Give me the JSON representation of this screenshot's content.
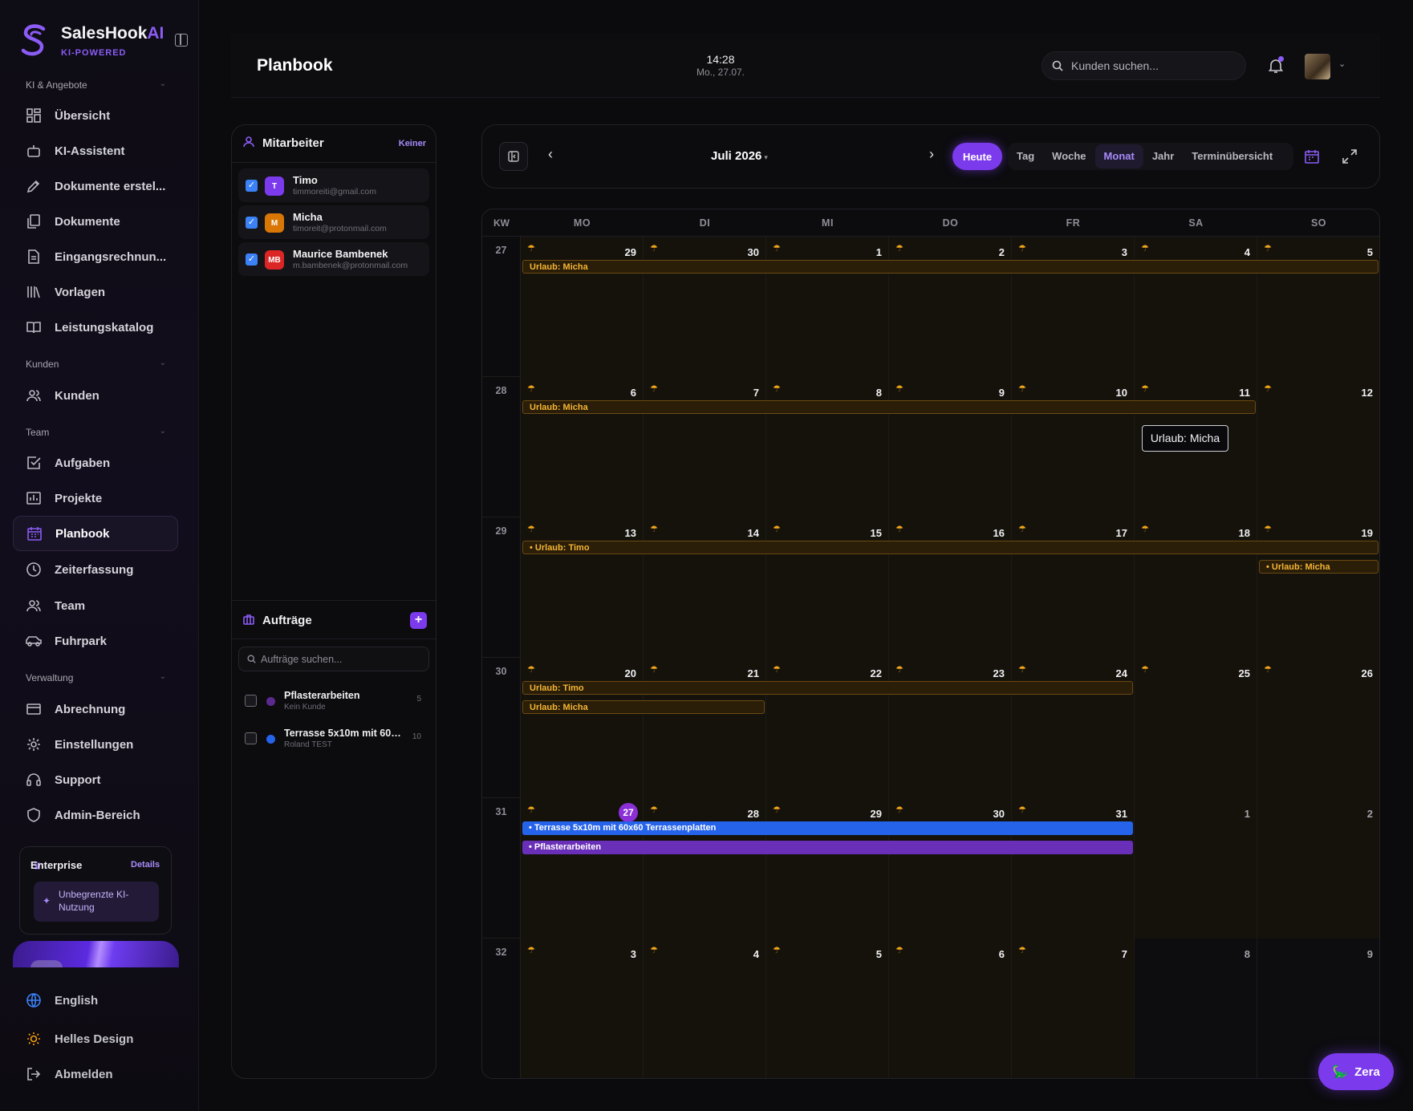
{
  "brand": {
    "name": "SalesHook",
    "name_ai": "AI",
    "tagline": "KI-POWERED"
  },
  "sidebar": {
    "sections": [
      {
        "label": "KI & Angebote"
      },
      {
        "label": "Kunden"
      },
      {
        "label": "Team"
      },
      {
        "label": "Verwaltung"
      }
    ],
    "items": [
      {
        "label": "Übersicht",
        "icon": "dashboard-icon"
      },
      {
        "label": "KI-Assistent",
        "icon": "robot-icon"
      },
      {
        "label": "Dokumente erstel...",
        "icon": "pen-icon"
      },
      {
        "label": "Dokumente",
        "icon": "documents-icon"
      },
      {
        "label": "Eingangsrechnun...",
        "icon": "invoice-icon"
      },
      {
        "label": "Vorlagen",
        "icon": "library-icon"
      },
      {
        "label": "Leistungskatalog",
        "icon": "book-icon"
      },
      {
        "label": "Kunden",
        "icon": "users-icon"
      },
      {
        "label": "Aufgaben",
        "icon": "check-square-icon"
      },
      {
        "label": "Projekte",
        "icon": "chart-icon"
      },
      {
        "label": "Planbook",
        "icon": "calendar-icon",
        "active": true
      },
      {
        "label": "Zeiterfassung",
        "icon": "clock-icon"
      },
      {
        "label": "Team",
        "icon": "team-icon"
      },
      {
        "label": "Fuhrpark",
        "icon": "car-icon"
      },
      {
        "label": "Abrechnung",
        "icon": "credit-card-icon"
      },
      {
        "label": "Einstellungen",
        "icon": "gear-icon"
      },
      {
        "label": "Support",
        "icon": "headset-icon"
      },
      {
        "label": "Admin-Bereich",
        "icon": "shield-icon"
      }
    ],
    "plan": {
      "title": "Enterprise",
      "details": "Details",
      "feature": "Unbegrenzte KI-Nutzung"
    },
    "bottom": [
      {
        "label": "English",
        "icon": "globe-icon"
      },
      {
        "label": "Helles Design",
        "icon": "sun-icon"
      },
      {
        "label": "Abmelden",
        "icon": "logout-icon"
      }
    ]
  },
  "header": {
    "title": "Planbook",
    "time": "14:28",
    "date": "Mo., 27.07.",
    "search_placeholder": "Kunden suchen..."
  },
  "employees": {
    "title": "Mitarbeiter",
    "clear": "Keiner",
    "list": [
      {
        "initials": "T",
        "name": "Timo",
        "email": "timmoreiti@gmail.com",
        "color": "#7c3aed"
      },
      {
        "initials": "M",
        "name": "Micha",
        "email": "timoreit@protonmail.com",
        "color": "#d97706"
      },
      {
        "initials": "MB",
        "name": "Maurice Bambenek",
        "email": "m.bambenek@protonmail.com",
        "color": "#dc2626"
      }
    ]
  },
  "jobs": {
    "title": "Aufträge",
    "add": "+",
    "search_placeholder": "Aufträge suchen...",
    "list": [
      {
        "title": "Pflasterarbeiten",
        "sub": "Kein Kunde",
        "count": "5",
        "color": "#6b21a8"
      },
      {
        "title": "Terrasse 5x10m mit 60x...",
        "sub": "Roland TEST",
        "count": "10",
        "color": "#2563eb"
      }
    ]
  },
  "toolbar": {
    "month": "Juli 2026",
    "today": "Heute",
    "views": [
      "Tag",
      "Woche",
      "Monat",
      "Jahr",
      "Terminübersicht"
    ],
    "active_view": "Monat"
  },
  "calendar": {
    "kw_label": "KW",
    "weekdays": [
      "MO",
      "DI",
      "MI",
      "DO",
      "FR",
      "SA",
      "SO"
    ],
    "weeks": [
      {
        "kw": "27",
        "days": [
          "29",
          "30",
          "1",
          "2",
          "3",
          "4",
          "5"
        ]
      },
      {
        "kw": "28",
        "days": [
          "6",
          "7",
          "8",
          "9",
          "10",
          "11",
          "12"
        ]
      },
      {
        "kw": "29",
        "days": [
          "13",
          "14",
          "15",
          "16",
          "17",
          "18",
          "19"
        ]
      },
      {
        "kw": "30",
        "days": [
          "20",
          "21",
          "22",
          "23",
          "24",
          "25",
          "26"
        ]
      },
      {
        "kw": "31",
        "days": [
          "27",
          "28",
          "29",
          "30",
          "31",
          "1",
          "2"
        ]
      },
      {
        "kw": "32",
        "days": [
          "3",
          "4",
          "5",
          "6",
          "7",
          "8",
          "9"
        ]
      }
    ],
    "events": [
      {
        "label": "Urlaub: Micha",
        "type": "urlaub"
      },
      {
        "label": "Urlaub: Micha",
        "type": "urlaub"
      },
      {
        "label": "• Urlaub: Timo",
        "type": "urlaub"
      },
      {
        "label": "• Urlaub: Micha",
        "type": "urlaub"
      },
      {
        "label": "Urlaub: Timo",
        "type": "urlaub"
      },
      {
        "label": "Urlaub: Micha",
        "type": "urlaub"
      },
      {
        "label": "• Terrasse 5x10m mit 60x60 Terrassenplatten",
        "type": "blue"
      },
      {
        "label": "• Pflasterarbeiten",
        "type": "purple"
      }
    ],
    "tooltip": "Urlaub: Micha"
  },
  "assistant": {
    "label": "Zera"
  },
  "colors": {
    "accent": "#7c3aed",
    "urlaub": "#f5b534",
    "holiday_icon": "#f0a61a"
  }
}
